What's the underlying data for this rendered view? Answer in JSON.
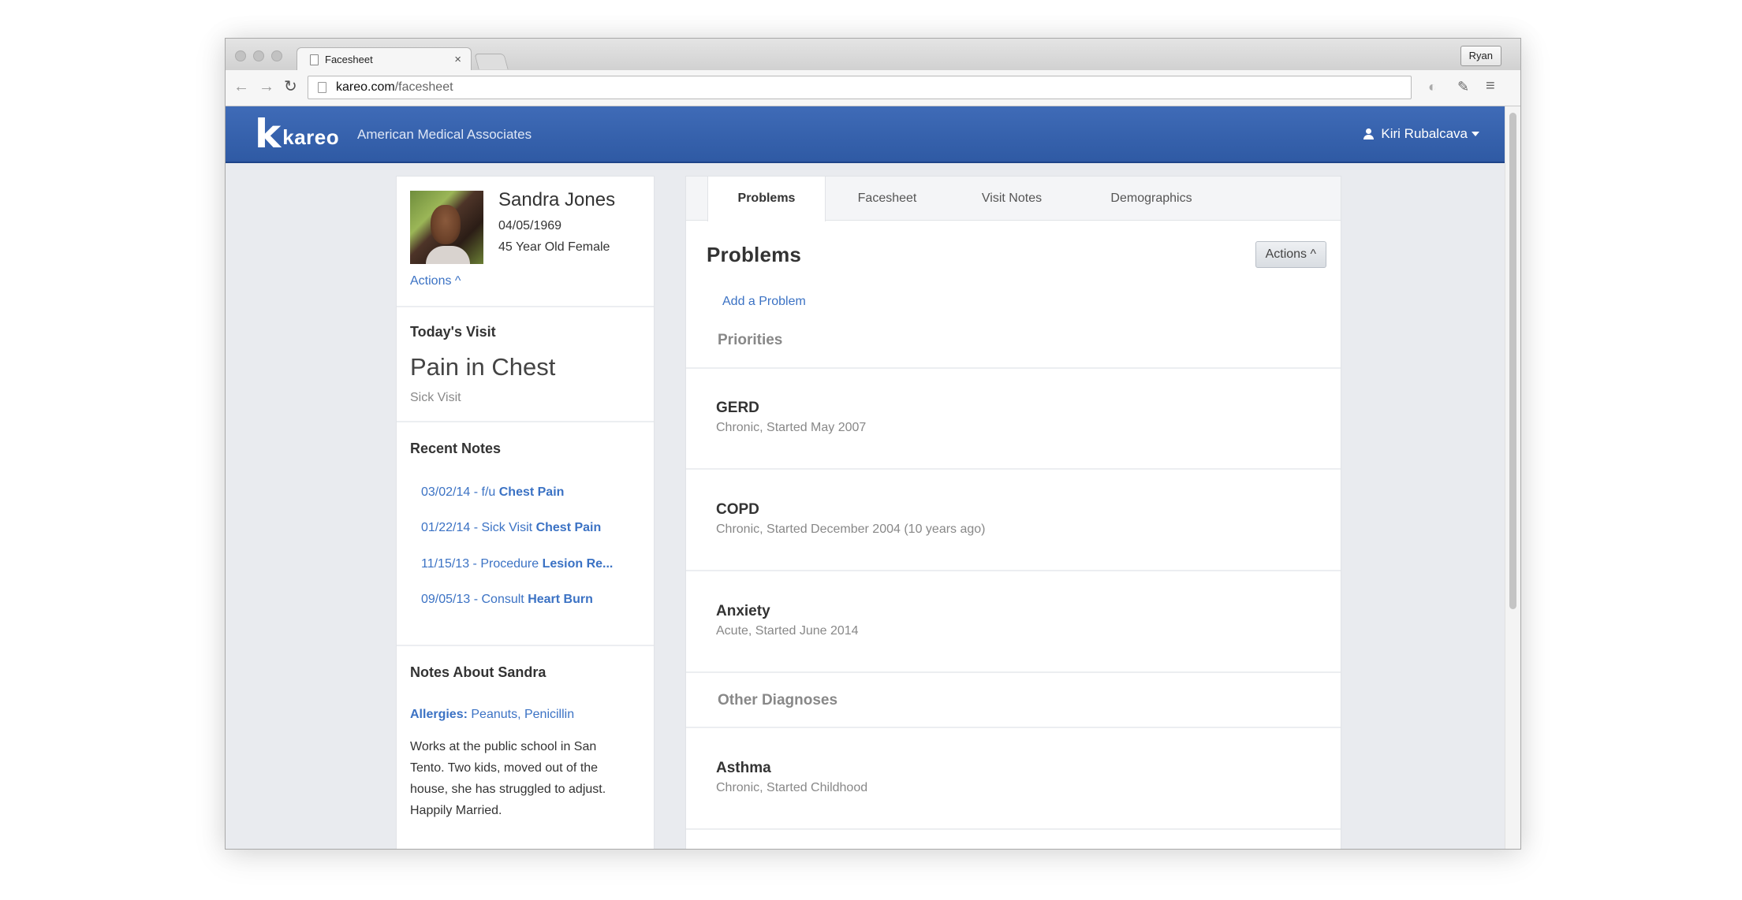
{
  "browser": {
    "tab_title": "Facesheet",
    "tab_close": "×",
    "profile": "Ryan",
    "url_host": "kareo.com",
    "url_path": "/facesheet"
  },
  "app": {
    "logo_mark": "k",
    "logo_text": "kareo",
    "practice": "American Medical Associates",
    "user_name": "Kiri Rubalcava"
  },
  "patient": {
    "name": "Sandra Jones",
    "dob": "04/05/1969",
    "age_sex": "45 Year Old Female",
    "actions": "Actions ^"
  },
  "todays_visit": {
    "heading": "Today's Visit",
    "reason": "Pain in Chest",
    "type": "Sick Visit"
  },
  "recent_notes": {
    "heading": "Recent Notes",
    "items": [
      {
        "prefix": "03/02/14 - f/u ",
        "bold": "Chest Pain"
      },
      {
        "prefix": "01/22/14 - Sick Visit ",
        "bold": "Chest Pain"
      },
      {
        "prefix": "11/15/13 - Procedure ",
        "bold": "Lesion Re..."
      },
      {
        "prefix": "09/05/13 - Consult ",
        "bold": "Heart Burn"
      }
    ]
  },
  "notes_about": {
    "heading": "Notes About Sandra",
    "allergies_label": "Allergies:",
    "allergies_value": " Peanuts, Penicillin",
    "text": "Works at the public school in San Tento. Two kids, moved out of the house, she has struggled to adjust. Happily Married."
  },
  "main": {
    "tabs": [
      {
        "label": "Problems",
        "active": true
      },
      {
        "label": "Facesheet"
      },
      {
        "label": "Visit Notes"
      },
      {
        "label": "Demographics"
      }
    ],
    "title": "Problems",
    "actions": "Actions ^",
    "add_problem": "Add a Problem",
    "priorities_label": "Priorities",
    "other_label": "Other Diagnoses",
    "priorities": [
      {
        "name": "GERD",
        "desc": "Chronic, Started May 2007"
      },
      {
        "name": "COPD",
        "desc": "Chronic, Started December 2004 (10 years ago)"
      },
      {
        "name": "Anxiety",
        "desc": "Acute, Started June 2014"
      }
    ],
    "other": [
      {
        "name": "Asthma",
        "desc": "Chronic, Started Childhood"
      }
    ]
  }
}
